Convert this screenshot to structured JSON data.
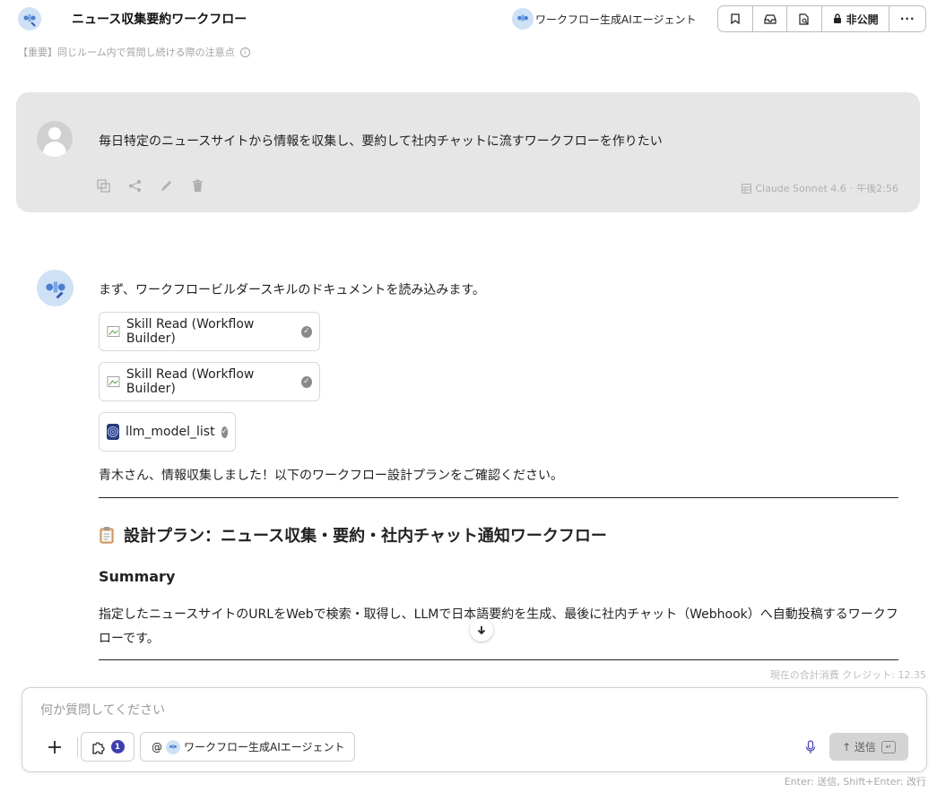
{
  "header": {
    "title": "ニュース収集要約ワークフロー",
    "agent_name": "ワークフロー生成AIエージェント",
    "visibility_label": "非公開",
    "more_label": "···"
  },
  "notice": {
    "text": "【重要】同じルーム内で質問し続ける際の注意点"
  },
  "user_message": {
    "text": "毎日特定のニュースサイトから情報を収集し、要約して社内チャットに流すワークフローを作りたい",
    "model": "Claude Sonnet 4.6",
    "separator": "·",
    "time": "午後2:56"
  },
  "ai_message": {
    "intro": "まず、ワークフロービルダースキルのドキュメントを読み込みます。",
    "tools": [
      {
        "label": "Skill Read (Workflow Builder)"
      },
      {
        "label": "Skill Read (Workflow Builder)"
      },
      {
        "label": "llm_model_list"
      }
    ],
    "confirm": "青木さん、情報収集しました！以下のワークフロー設計プランをご確認ください。",
    "plan_title": "設計プラン：ニュース収集・要約・社内チャット通知ワークフロー",
    "summary_heading": "Summary",
    "summary_text": "指定したニュースサイトのURLをWebで検索・取得し、LLMで日本語要約を生成、最後に社内チャット（Webhook）へ自動投稿するワークフローです。"
  },
  "credits": "現在の合計消費 クレジット: 12.35",
  "composer": {
    "placeholder": "何か質問してください",
    "skill_count": "1",
    "mention_prefix": "@",
    "mention_agent": "ワークフロー生成AIエージェント",
    "send_label": "↑ 送信",
    "enter_key": "↵",
    "hint": "Enter: 送信, Shift+Enter: 改行"
  },
  "colors": {
    "user_bubble": "#e6e6e6",
    "badge": "#3d3fb0",
    "avatar_bg": "#cfe1f5"
  }
}
